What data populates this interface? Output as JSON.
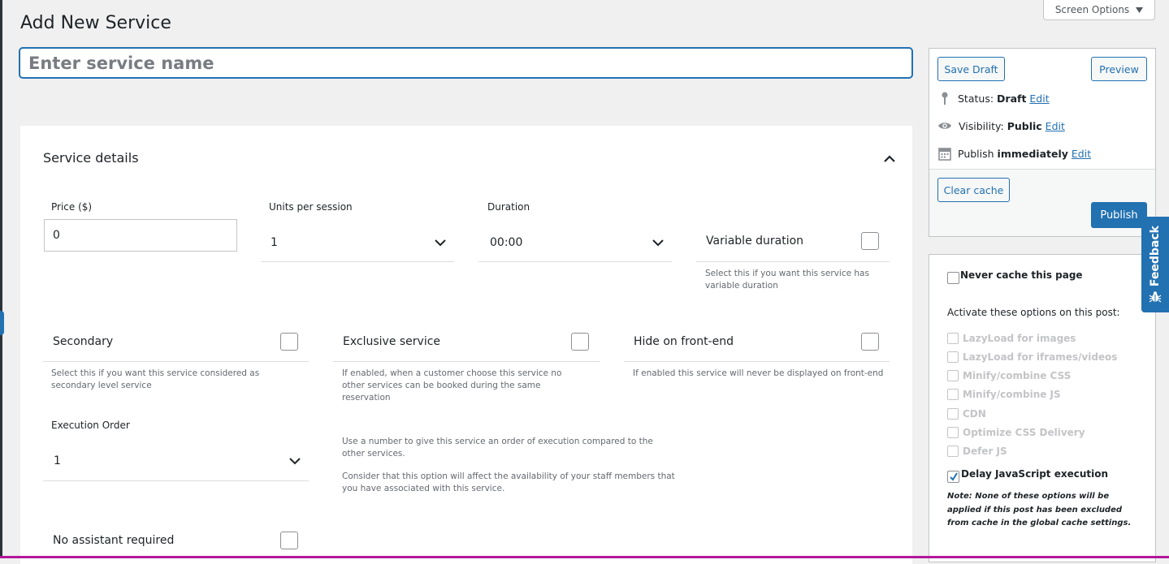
{
  "page": {
    "title": "Add New Service"
  },
  "screen_options": {
    "label": "Screen Options"
  },
  "title_field": {
    "placeholder": "Enter service name",
    "value": ""
  },
  "service_details": {
    "heading": "Service details",
    "price": {
      "label": "Price ($)",
      "value": "0"
    },
    "units_per_session": {
      "label": "Units per session",
      "value": "1"
    },
    "duration": {
      "label": "Duration",
      "value": "00:00"
    },
    "variable_duration": {
      "label": "Variable duration",
      "help": "Select this if you want this service has variable duration",
      "checked": false
    },
    "secondary": {
      "label": "Secondary",
      "help": "Select this if you want this service considered as secondary level service",
      "checked": false
    },
    "exclusive": {
      "label": "Exclusive service",
      "help": "If enabled, when a customer choose this service no other services can be booked during the same reservation",
      "checked": false
    },
    "hide_frontend": {
      "label": "Hide on front-end",
      "help": "If enabled this service will never be displayed on front-end",
      "checked": false
    },
    "execution_order": {
      "label": "Execution Order",
      "value": "1",
      "help1": "Use a number to give this service an order of execution compared to the other services.",
      "help2": "Consider that this option will affect the availability of your staff members that you have associated with this service."
    },
    "no_assistant": {
      "label": "No assistant required",
      "checked": false
    }
  },
  "publish_box": {
    "save_draft": "Save Draft",
    "preview": "Preview",
    "status_label": "Status:",
    "status_value": "Draft",
    "visibility_label": "Visibility:",
    "visibility_value": "Public",
    "publish_label": "Publish",
    "publish_value": "immediately",
    "edit": "Edit",
    "clear_cache": "Clear cache",
    "publish": "Publish"
  },
  "cache_box": {
    "never_cache": "Never cache this page",
    "activate": "Activate these options on this post:",
    "options": [
      {
        "label": "LazyLoad for images",
        "checked": false
      },
      {
        "label": "LazyLoad for iframes/videos",
        "checked": false
      },
      {
        "label": "Minify/combine CSS",
        "checked": false
      },
      {
        "label": "Minify/combine JS",
        "checked": false
      },
      {
        "label": "CDN",
        "checked": false
      },
      {
        "label": "Optimize CSS Delivery",
        "checked": false
      },
      {
        "label": "Defer JS",
        "checked": false
      },
      {
        "label": "Delay JavaScript execution",
        "checked": true
      }
    ],
    "note": "Note: None of these options will be applied if this post has been excluded from cache in the global cache settings."
  },
  "feedback": {
    "label": "Feedback"
  },
  "colors": {
    "accent": "#2271b1",
    "bottom_bar": "#b3179a"
  },
  "icons": [
    "chevron-up-icon",
    "chevron-down-icon",
    "pin-icon",
    "eye-icon",
    "calendar-icon",
    "bug-icon",
    "triangle-down-icon",
    "checkmark-icon"
  ]
}
